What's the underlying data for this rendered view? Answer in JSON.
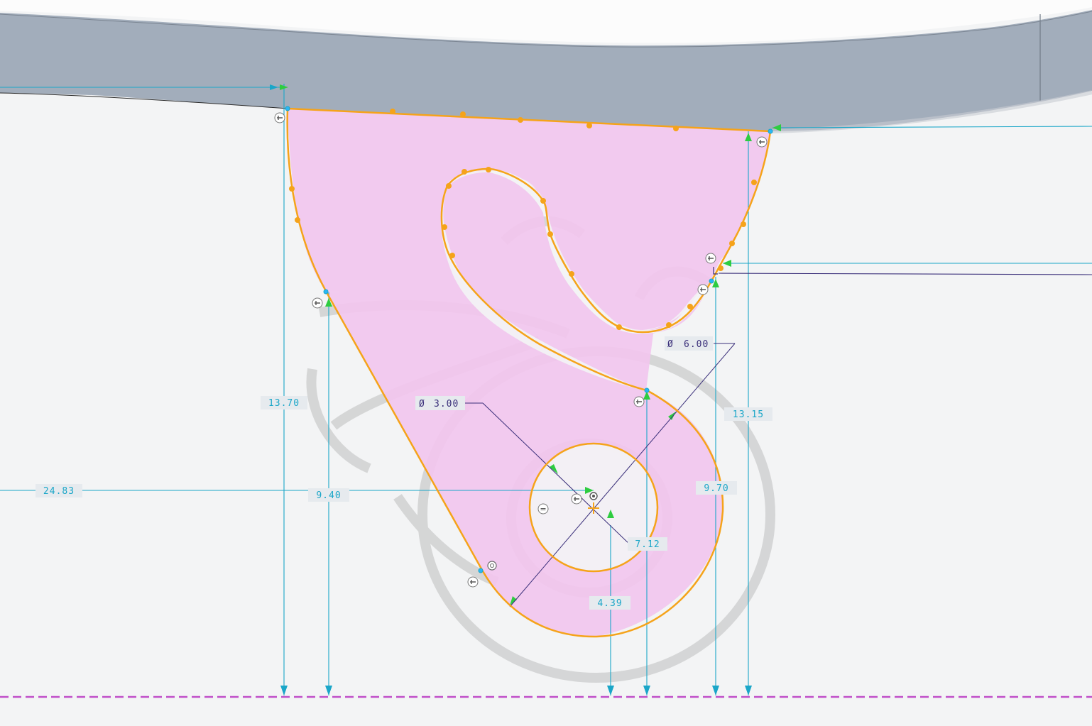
{
  "sketch": {
    "dimensions": {
      "d_13_70": "13.70",
      "d_9_40": "9.40",
      "d_24_83": "24.83",
      "d_13_15": "13.15",
      "d_9_70": "9.70",
      "d_7_12": "7.12",
      "d_4_39": "4.39"
    },
    "diameters": {
      "small_symbol": "Ø",
      "small_value": "3.00",
      "large_symbol": "Ø",
      "large_value": "6.00"
    },
    "constraint_equal": "="
  },
  "colors": {
    "profile": "#f5a31a",
    "fill": "#f2c6ee",
    "dimension": "#1aa6c8",
    "reference": "#c04fc9",
    "part": "#a2adbb"
  }
}
